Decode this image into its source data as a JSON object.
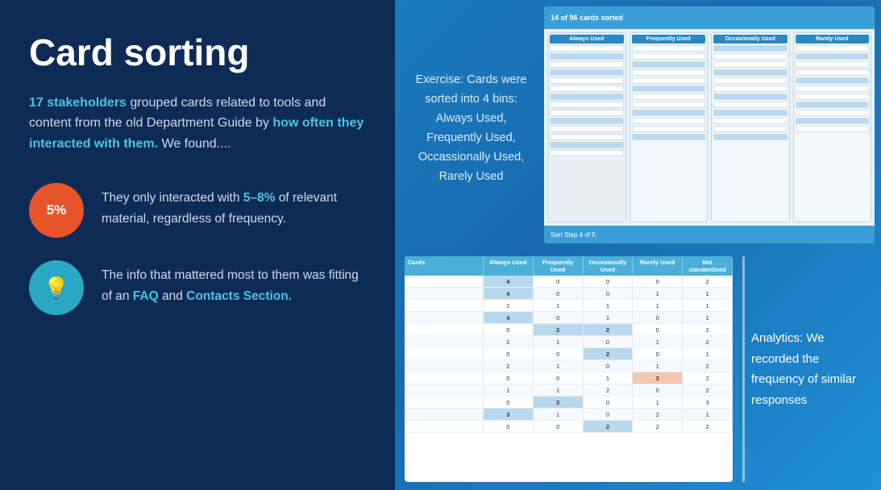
{
  "left": {
    "title": "Card sorting",
    "description_part1": "17 stakeholders",
    "description_part2": " grouped cards related to tools and content from the old Department Guide by ",
    "description_highlight": "how often they interacted with them.",
    "description_part3": " We found....",
    "stats": [
      {
        "id": "percentage",
        "badge_text": "5%",
        "badge_class": "circle-orange",
        "text_part1": "They only interacted with ",
        "text_highlight": "5–8%",
        "text_part2": " of relevant material, regardless of frequency."
      },
      {
        "id": "faq",
        "badge_class": "circle-teal",
        "text_part1": "The info that mattered most to them was fitting of an ",
        "text_highlight1": "FAQ",
        "text_part2": " and ",
        "text_highlight2": "Contacts Section.",
        "text_part3": ""
      }
    ]
  },
  "right": {
    "exercise_text": "Exercise: Cards were sorted into 4 bins: Always Used, Frequently Used, Occassionally Used, Rarely Used",
    "screenshot": {
      "col_headers": [
        "Always Used",
        "Frequently Used",
        "Occasionally Used",
        "Rarely Used",
        "Not standardized"
      ],
      "card_columns": [
        "Always Used",
        "Frequently Used",
        "Occasionally Used",
        "Rarely Used"
      ]
    },
    "table": {
      "headers": [
        "Cards",
        "Always Used",
        "Frequently Used",
        "Occasionally Used",
        "Rarely Used",
        "Not standardized"
      ],
      "rows": [
        [
          "",
          "4",
          "0",
          "0",
          "2"
        ],
        [
          "",
          "4",
          "0",
          "0",
          "1",
          "1"
        ],
        [
          "",
          "2",
          "1",
          "1",
          "1",
          "1"
        ],
        [
          "",
          "4",
          "0",
          "1",
          "0",
          "1"
        ],
        [
          "",
          "0",
          "2",
          "2",
          "0",
          "2"
        ],
        [
          "",
          "2",
          "1",
          "0",
          "1",
          "2"
        ],
        [
          "",
          "0",
          "0",
          "2",
          "0",
          "1"
        ],
        [
          "",
          "2",
          "1",
          "0",
          "1",
          "2"
        ],
        [
          "",
          "0",
          "0",
          "1",
          "3",
          "2"
        ],
        [
          "",
          "1",
          "1",
          "2",
          "0",
          "2"
        ],
        [
          "",
          "0",
          "2",
          "0",
          "1",
          "3"
        ],
        [
          "",
          "3",
          "1",
          "0",
          "2",
          "1"
        ],
        [
          "",
          "0",
          "0",
          "2",
          "2",
          "2"
        ]
      ]
    },
    "analytics_text": "Analytics: We recorded the frequency of similar responses"
  },
  "icons": {
    "bulb": "💡",
    "percentage": "5%"
  }
}
